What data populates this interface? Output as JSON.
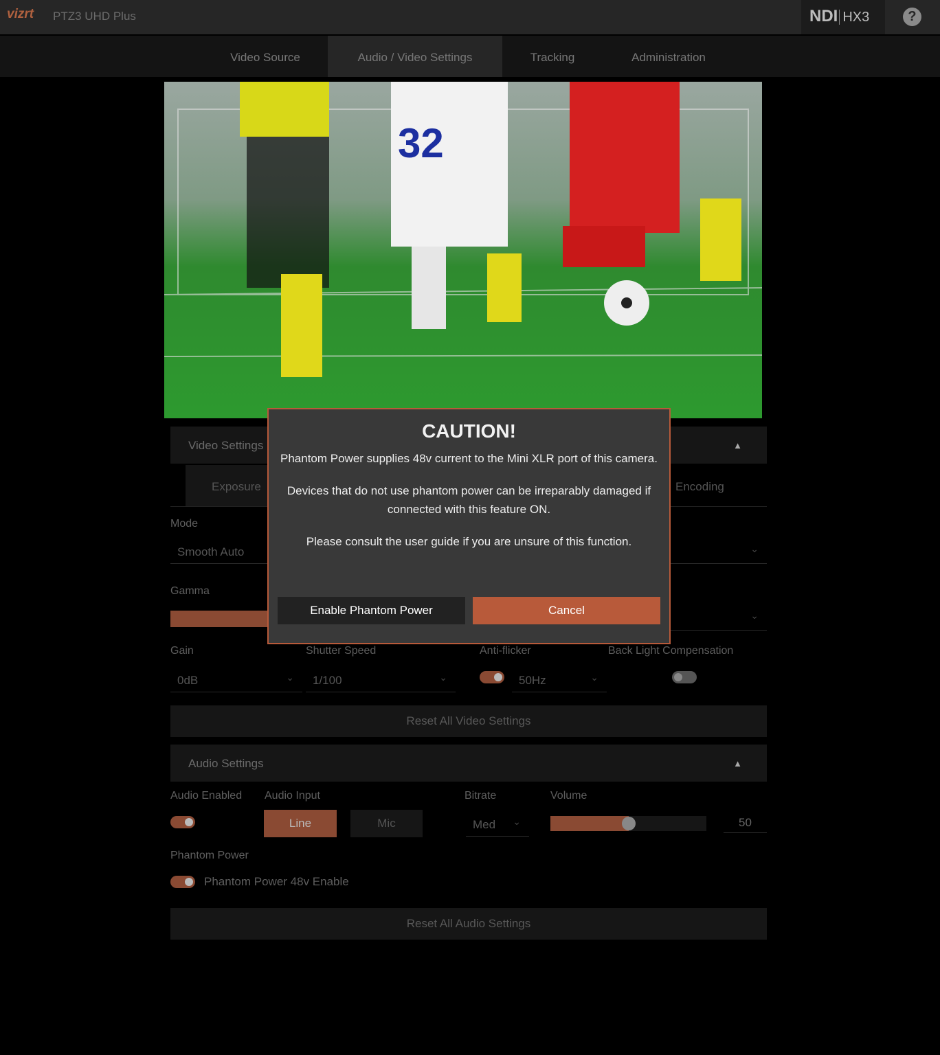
{
  "header": {
    "logo": "vizrt",
    "product": "PTZ3 UHD Plus",
    "ndi": "NDI",
    "hx": "HX3",
    "help_icon": "question-circle-icon"
  },
  "nav": {
    "tabs": [
      {
        "label": "Video Source"
      },
      {
        "label": "Audio / Video Settings",
        "active": true
      },
      {
        "label": "Tracking"
      },
      {
        "label": "Administration"
      }
    ]
  },
  "video_settings": {
    "title": "Video Settings",
    "tabs": [
      "Exposure",
      "Encoding"
    ],
    "mode_label": "Mode",
    "mode_value": "Smooth Auto",
    "gamma_label": "Gamma",
    "gain_label": "Gain",
    "gain_value": "0dB",
    "shutter_label": "Shutter Speed",
    "shutter_value": "1/100",
    "antiflicker_label": "Anti-flicker",
    "antiflicker_value": "50Hz",
    "antiflicker_on": true,
    "blc_label": "Back Light Compensation",
    "blc_on": false,
    "reset": "Reset All Video Settings"
  },
  "audio_settings": {
    "title": "Audio Settings",
    "enabled_label": "Audio Enabled",
    "enabled_on": true,
    "input_label": "Audio Input",
    "input_options": [
      "Line",
      "Mic"
    ],
    "input_selected": "Line",
    "bitrate_label": "Bitrate",
    "bitrate_value": "Med",
    "volume_label": "Volume",
    "volume_value": "50",
    "phantom_label": "Phantom Power",
    "phantom_toggle_label": "Phantom Power 48v Enable",
    "phantom_on": true,
    "reset": "Reset All Audio Settings"
  },
  "modal": {
    "title": "CAUTION!",
    "p1": "Phantom Power supplies 48v current to the Mini XLR port of this camera.",
    "p2": "Devices that do not use phantom power can be irreparably damaged if connected with this feature ON.",
    "p3": "Please consult the user guide if you are unsure of this function.",
    "confirm": "Enable Phantom Power",
    "cancel": "Cancel"
  },
  "colors": {
    "accent": "#b85a3a",
    "bg": "#000000",
    "panel": "#161616"
  }
}
